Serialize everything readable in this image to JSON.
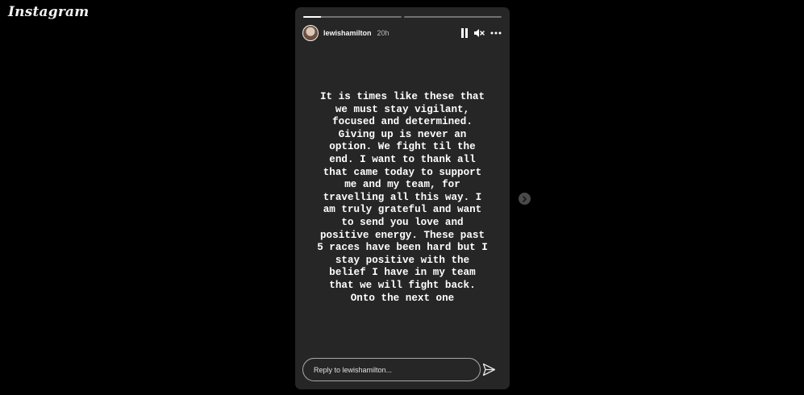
{
  "app": {
    "logo_text": "Instagram"
  },
  "story": {
    "progress": [
      0.18,
      0
    ],
    "username": "lewishamilton",
    "time_ago": "20h",
    "text": "It is times like these that\nwe must stay vigilant,\nfocused and determined.\nGiving up is never an\noption. We fight til the\nend. I want to thank all\nthat came today to support\nme and my team, for\ntravelling all this way. I\nam truly grateful and want\nto send you love and\npositive energy. These past\n5 races have been hard but I\nstay positive with the\nbelief I have in my team\nthat we will fight back.\nOnto the next one",
    "reply_placeholder": "Reply to lewishamilton...",
    "controls": {
      "pause": "pause-icon",
      "mute": "speaker-muted-icon",
      "more": "more-options-icon"
    }
  },
  "colors": {
    "background": "#000000",
    "story_background": "#262626",
    "text": "#ffffff"
  }
}
